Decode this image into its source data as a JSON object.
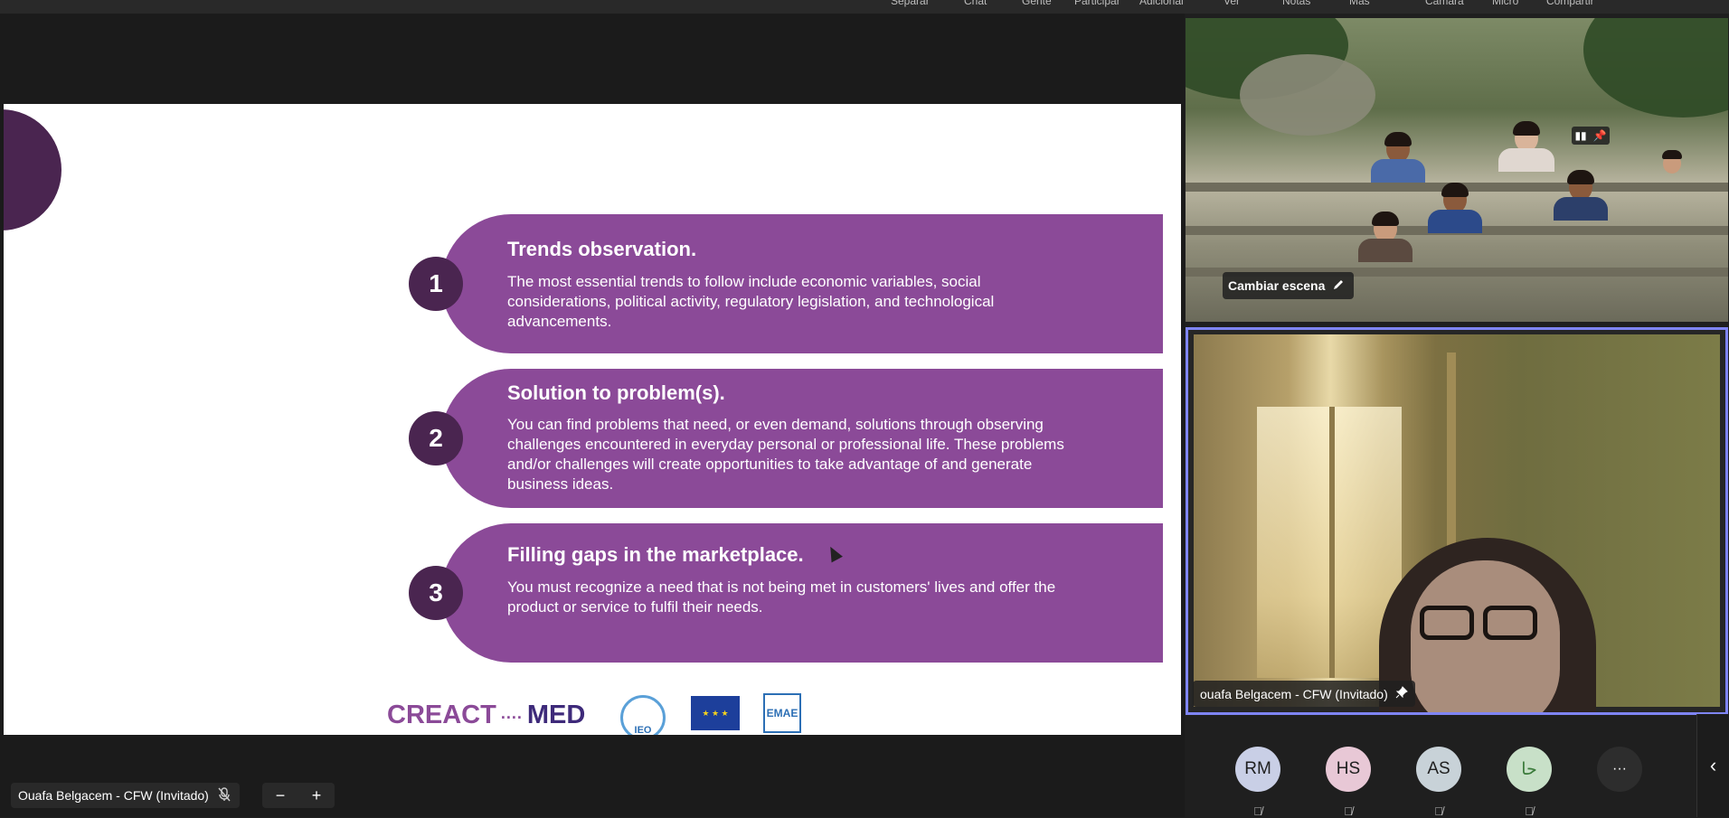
{
  "top_menu": {
    "items": [
      "Separar",
      "Chat",
      "Gente",
      "Participar",
      "Adicional",
      "Ver",
      "Notas",
      "Más",
      "Cámara",
      "Micro",
      "Compartir"
    ]
  },
  "slide": {
    "rows": [
      {
        "number": "1",
        "title": "Trends observation.",
        "body": "The most essential trends to follow include economic variables, social considerations, political activity, regulatory legislation, and technological advancements."
      },
      {
        "number": "2",
        "title": "Solution to problem(s).",
        "body": "You can find problems that need, or even demand, solutions through observing challenges encountered in everyday personal or professional life. These problems and/or challenges will create opportunities to take advantage of and generate business ideas."
      },
      {
        "number": "3",
        "title": "Filling gaps in the marketplace.",
        "body": "You must recognize a need that is not being met in customers' lives and offer the product or service to fulfil their needs."
      }
    ],
    "logos": {
      "creact_a": "CREACT",
      "creact_b": "MED",
      "ieo": "IEO",
      "emae": "EMAE"
    }
  },
  "presenter_bar": {
    "name": "Ouafa Belgacem - CFW (Invitado)",
    "zoom_out": "−",
    "zoom_in": "+"
  },
  "scene_tile": {
    "label": "Cambiar escena"
  },
  "speaker_tile": {
    "name": "ouafa Belgacem - CFW (Invitado)"
  },
  "roster": {
    "participants": [
      {
        "initials": "RM",
        "color": "#c9cfe6"
      },
      {
        "initials": "HS",
        "color": "#e8c8d6"
      },
      {
        "initials": "AS",
        "color": "#c8d2d8"
      },
      {
        "initials": "حا",
        "color": "#c8e0c8"
      }
    ],
    "more": "···"
  },
  "colors": {
    "accent": "#7f85f5",
    "slide_purple": "#8b4a98",
    "slide_dark": "#4a2550"
  }
}
